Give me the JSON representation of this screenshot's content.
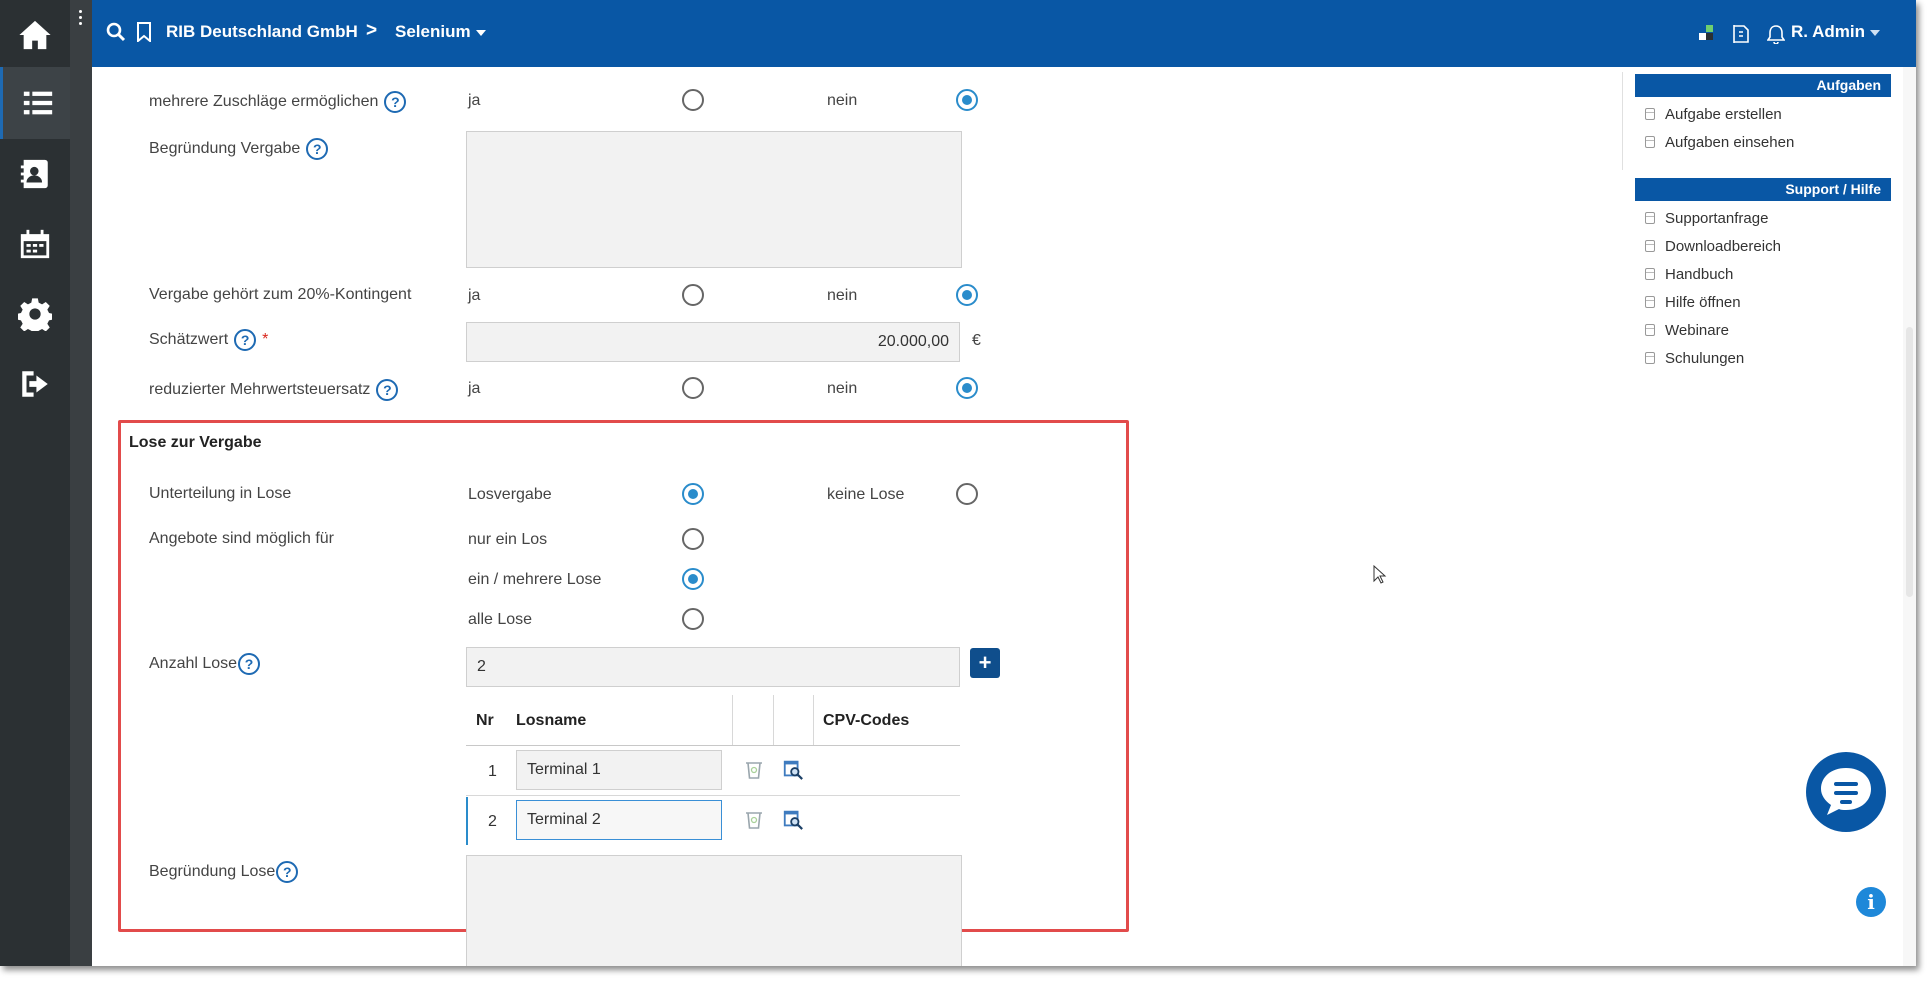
{
  "header": {
    "org": "RIB Deutschland GmbH",
    "separator": ">",
    "project": "Selenium",
    "user": "R. Admin"
  },
  "sidebar": {
    "items": [
      {
        "icon": "home-icon"
      },
      {
        "icon": "list-icon"
      },
      {
        "icon": "contact-book-icon"
      },
      {
        "icon": "calendar-icon"
      },
      {
        "icon": "gear-icon"
      },
      {
        "icon": "logout-icon"
      }
    ]
  },
  "form": {
    "zuschlaege": {
      "label": "mehrere Zuschläge ermöglichen",
      "yes": "ja",
      "no": "nein",
      "selected": "nein"
    },
    "begruendung_vergabe": {
      "label": "Begründung Vergabe",
      "value": ""
    },
    "kontingent": {
      "label": "Vergabe gehört zum 20%-Kontingent",
      "yes": "ja",
      "no": "nein",
      "selected": "nein"
    },
    "schaetzwert": {
      "label": "Schätzwert",
      "required": "*",
      "value": "20.000,00",
      "unit": "€"
    },
    "mwst": {
      "label": "reduzierter Mehrwertsteuersatz",
      "yes": "ja",
      "no": "nein",
      "selected": "nein"
    }
  },
  "lose": {
    "title": "Lose zur Vergabe",
    "unterteilung": {
      "label": "Unterteilung in Lose",
      "opt1": "Losvergabe",
      "opt2": "keine Lose",
      "selected": "Losvergabe"
    },
    "angebote": {
      "label": "Angebote sind möglich für",
      "options": [
        "nur ein Los",
        "ein / mehrere Lose",
        "alle Lose"
      ],
      "selected": "ein / mehrere Lose"
    },
    "anzahl": {
      "label": "Anzahl Lose",
      "value": "2",
      "add_label": "+"
    },
    "table": {
      "headers": {
        "nr": "Nr",
        "name": "Losname",
        "cpv": "CPV-Codes"
      },
      "rows": [
        {
          "nr": "1",
          "name": "Terminal 1"
        },
        {
          "nr": "2",
          "name": "Terminal 2"
        }
      ]
    },
    "begruendung": {
      "label": "Begründung Lose",
      "value": ""
    }
  },
  "right_panel": {
    "aufgaben": {
      "title": "Aufgaben",
      "items": [
        "Aufgabe erstellen",
        "Aufgaben einsehen"
      ]
    },
    "support": {
      "title": "Support / Hilfe",
      "items": [
        "Supportanfrage",
        "Downloadbereich",
        "Handbuch",
        "Hilfe öffnen",
        "Webinare",
        "Schulungen"
      ]
    }
  },
  "help_glyph": "?",
  "info_glyph": "i",
  "colors": {
    "header": "#0957a5",
    "sidebar": "#2b3033",
    "accent": "#2a8ccb",
    "highlight": "#e24b4b"
  }
}
